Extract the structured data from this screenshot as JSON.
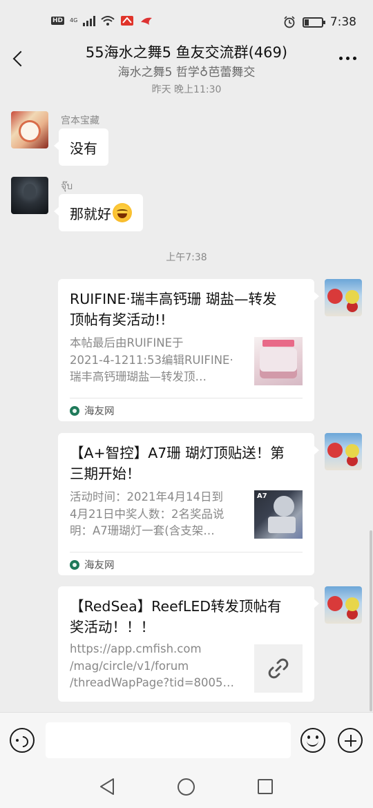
{
  "status_bar": {
    "hd": "HD",
    "network": "4G",
    "time": "7:38"
  },
  "header": {
    "title": "55海水之舞5 鱼友交流群(469)",
    "subtitle": "海水之舞5 哲学♁芭蕾舞交"
  },
  "messages": {
    "time_1": "昨天 晚上11:30",
    "msg1": {
      "sender": "宫本宝藏",
      "text": "没有"
    },
    "msg2": {
      "sender": "จุ๊บ",
      "text": "那就好"
    },
    "time_2": "上午7:38"
  },
  "cards": [
    {
      "title_lines": [
        "RUIFINE·瑞丰高钙珊 瑚盐—转发",
        "顶帖有奖活动!!"
      ],
      "desc_lines": [
        "本帖最后由RUIFINE于",
        "2021-4-1211:53编辑RUIFINE·",
        "瑞丰高钙珊瑚盐—转发顶…"
      ],
      "source": "海友网"
    },
    {
      "title_lines": [
        "【A+智控】A7珊 瑚灯顶贴送！第",
        "三期开始！"
      ],
      "desc_lines": [
        "活动时间：2021年4月14日到",
        "4月21日中奖人数：2名奖品说",
        "明：A7珊瑚灯一套(含支架…"
      ],
      "thumb_label": "A7",
      "source": "海友网"
    },
    {
      "title_lines": [
        "【RedSea】ReefLED转发顶帖有",
        "奖活动！！！"
      ],
      "desc_lines": [
        "https://app.cmfish.com",
        "/mag/circle/v1/forum",
        "/threadWapPage?tid=8005…"
      ]
    }
  ],
  "input": {
    "placeholder": ""
  }
}
